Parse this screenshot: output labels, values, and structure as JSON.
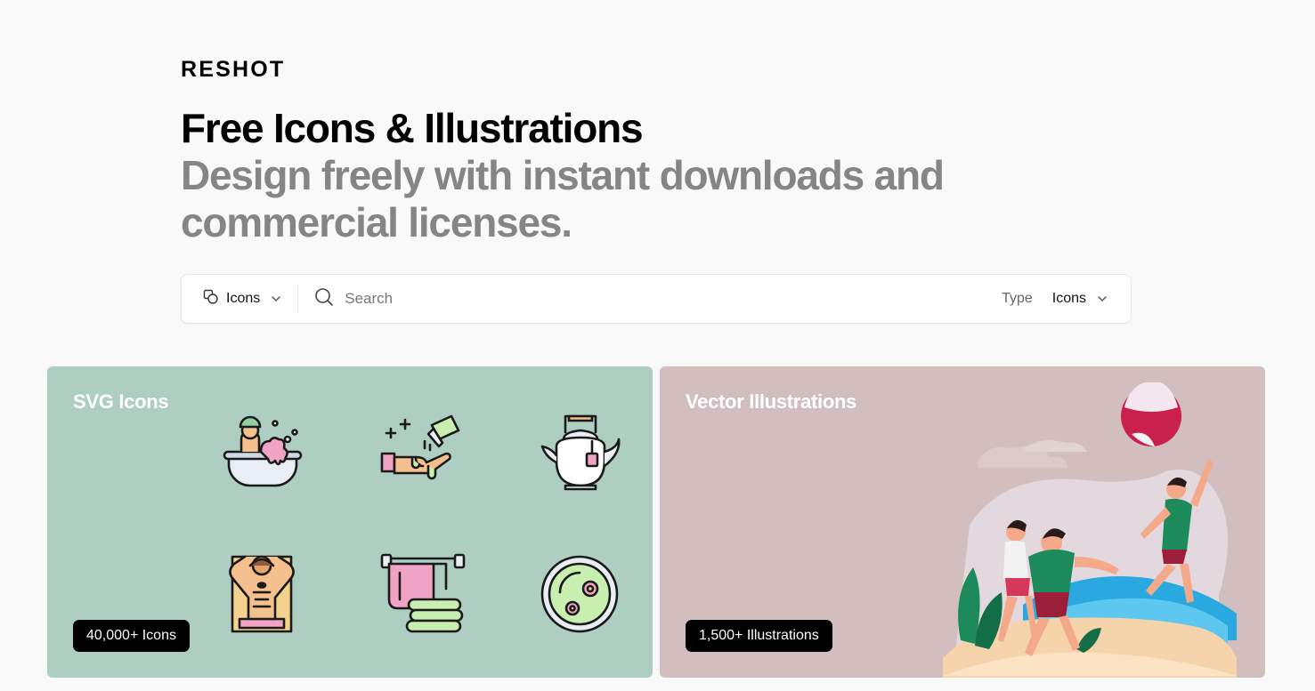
{
  "brand": {
    "logo_text": "RESHOT"
  },
  "hero": {
    "title": "Free Icons & Illustrations",
    "subtitle": "Design freely with instant downloads and commercial licenses."
  },
  "search": {
    "category_label": "Icons",
    "placeholder": "Search",
    "type_label": "Type",
    "type_value": "Icons"
  },
  "cards": {
    "icons": {
      "title": "SVG Icons",
      "badge": "40,000+ Icons",
      "bg": "#afcec2"
    },
    "illustrations": {
      "title": "Vector Illustrations",
      "badge": "1,500+ Illustrations",
      "bg": "#d2bebe"
    }
  },
  "icon_names": [
    "bath-icon",
    "hand-wash-icon",
    "teapot-icon",
    "massage-icon",
    "towels-icon",
    "spa-bowl-icon"
  ]
}
